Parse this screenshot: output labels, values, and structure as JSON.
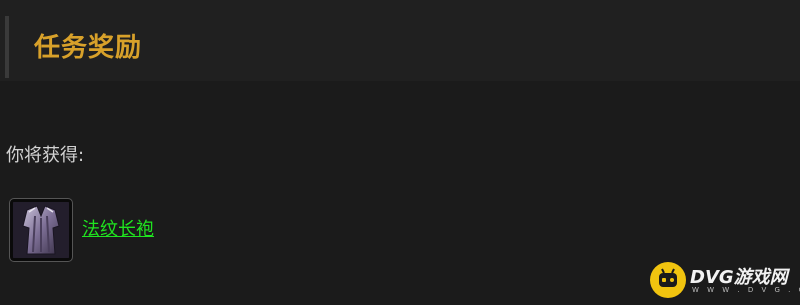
{
  "header": {
    "title": "任务奖励"
  },
  "rewards": {
    "prompt": "你将获得:",
    "items": [
      {
        "name": "法纹长袍",
        "icon": "robe-icon",
        "name_color": "#1fe51f"
      }
    ]
  },
  "watermark": {
    "brand": "DVG游戏网",
    "url": "W W W . D V G . C N"
  },
  "colors": {
    "title": "#d8a12a",
    "item_link": "#1fe51f",
    "background": "#1b1b1b",
    "watermark_logo": "#f1c40f"
  }
}
